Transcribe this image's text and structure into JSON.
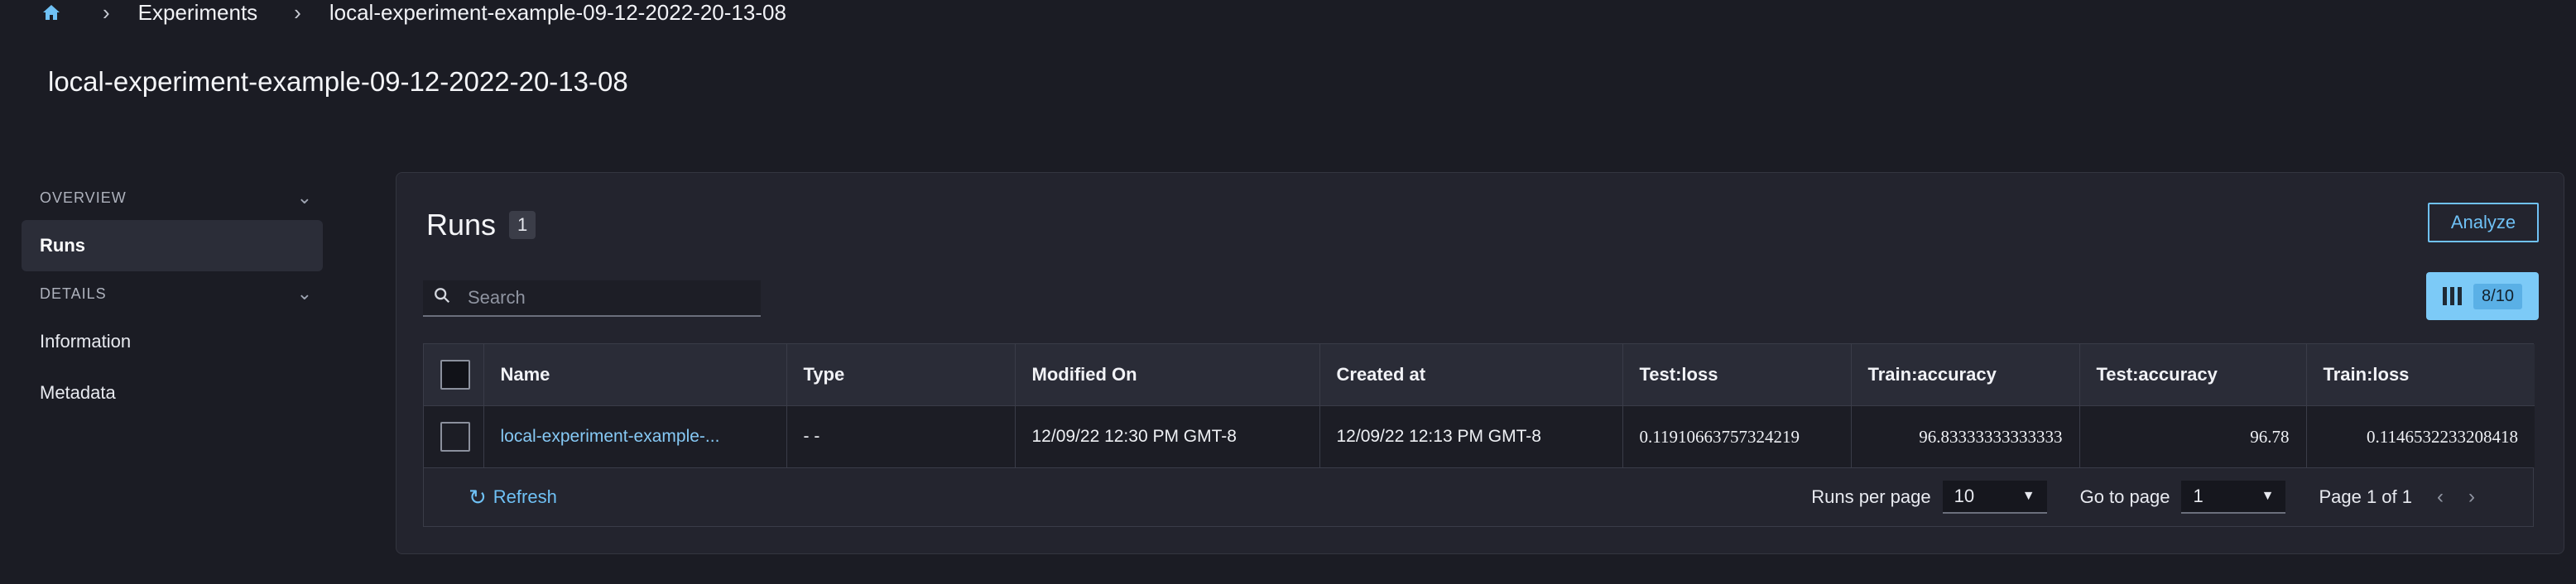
{
  "breadcrumb": {
    "home_icon": "home-icon",
    "items": [
      "Experiments",
      "local-experiment-example-09-12-2022-20-13-08"
    ]
  },
  "page_title": "local-experiment-example-09-12-2022-20-13-08",
  "sidebar": {
    "overview_label": "OVERVIEW",
    "runs_label": "Runs",
    "details_label": "DETAILS",
    "information_label": "Information",
    "metadata_label": "Metadata"
  },
  "runs": {
    "title": "Runs",
    "count": "1",
    "analyze_label": "Analyze",
    "columns_label": "8/10",
    "search_placeholder": "Search",
    "headers": [
      "Name",
      "Type",
      "Modified On",
      "Created at",
      "Test:loss",
      "Train:accuracy",
      "Test:accuracy",
      "Train:loss"
    ],
    "rows": [
      {
        "name": "local-experiment-example-...",
        "type": "- -",
        "modified_on": "12/09/22 12:30 PM GMT-8",
        "created_at": "12/09/22 12:13 PM GMT-8",
        "test_loss": "0.11910663757324219",
        "train_accuracy": "96.83333333333333",
        "test_accuracy": "96.78",
        "train_loss": "0.1146532233208418"
      }
    ],
    "footer": {
      "refresh_label": "Refresh",
      "runs_per_page_label": "Runs per page",
      "runs_per_page_value": "10",
      "go_to_page_label": "Go to page",
      "go_to_page_value": "1",
      "page_info": "Page 1 of 1"
    }
  },
  "colors": {
    "accent": "#6fc1f5",
    "background": "#1b1c24",
    "panel": "#23242e"
  }
}
